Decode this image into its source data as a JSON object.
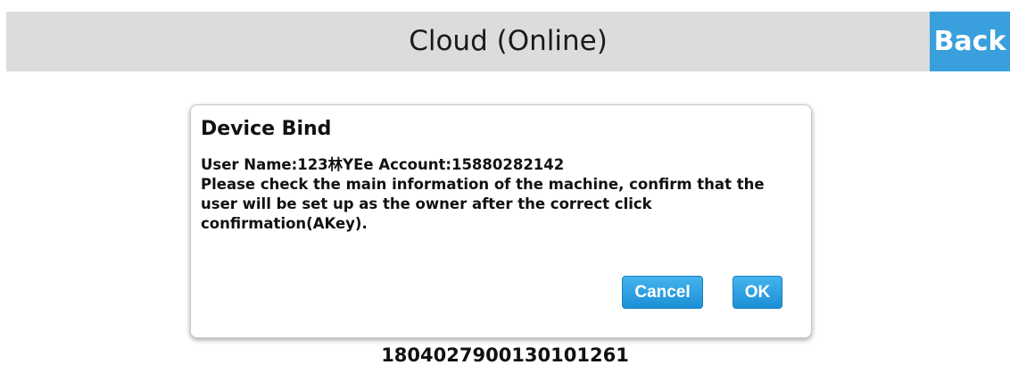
{
  "header": {
    "title": "Cloud (Online)",
    "back_label": "Back"
  },
  "dialog": {
    "title": "Device Bind",
    "user_line": "User Name:123林YEe Account:15880282142",
    "message": "Please check the main information of the machine, confirm that the user will be set up as the owner after the correct click confirmation(AKey).",
    "cancel_label": "Cancel",
    "ok_label": "OK"
  },
  "device": {
    "id": "1804027900130101261"
  },
  "colors": {
    "header_bg": "#dcdcdc",
    "accent": "#3aa0dd",
    "button_blue": "#1b8fd6"
  }
}
